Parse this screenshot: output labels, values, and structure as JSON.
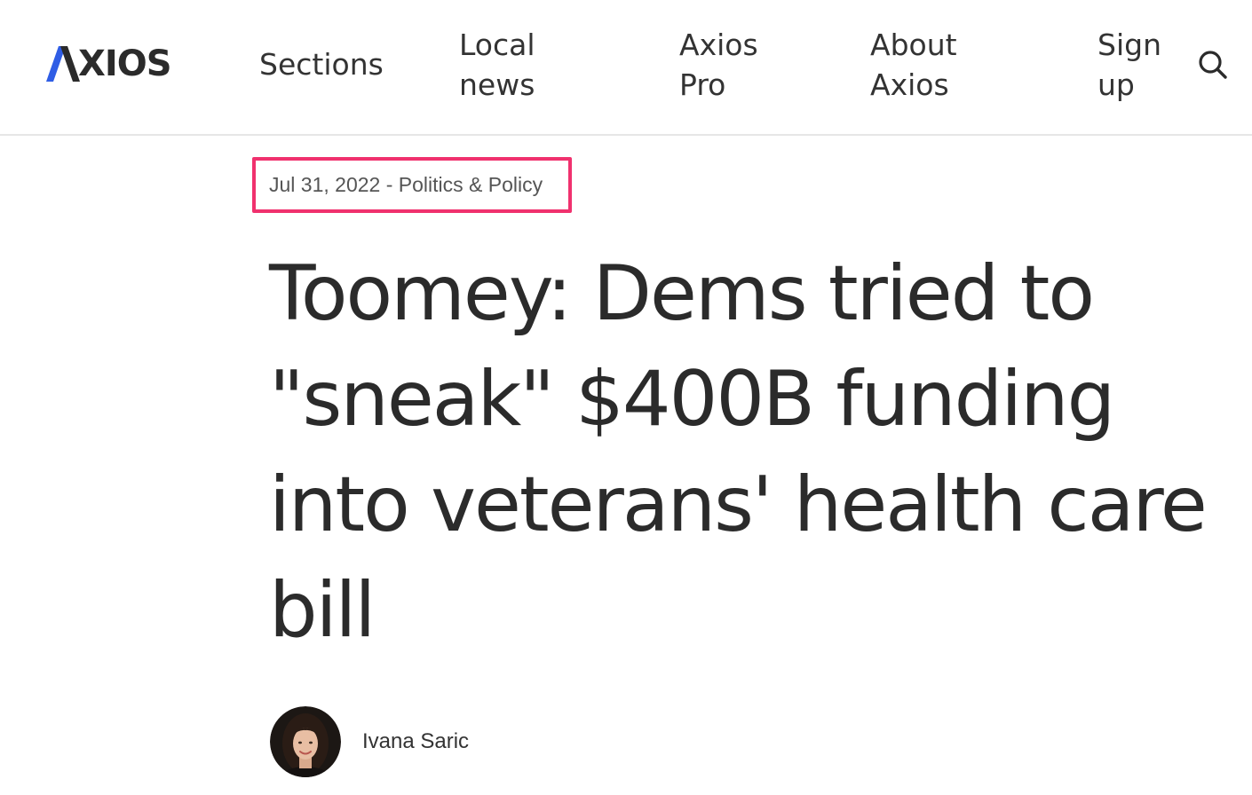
{
  "header": {
    "logo_text": "XIOS",
    "logo_label": "AXIOS",
    "logo_icon": "axios-a-mark",
    "nav": {
      "sections": "Sections",
      "local_news": "Local news",
      "axios_pro": "Axios Pro",
      "about_axios": "About Axios",
      "sign_up": "Sign up"
    },
    "search_icon": "search-icon"
  },
  "article": {
    "date": "Jul 31, 2022",
    "separator": " - ",
    "category": "Politics & Policy",
    "headline": "Toomey: Dems tried to \"sneak\" $400B funding into veterans' health care bill",
    "author": "Ivana Saric"
  },
  "colors": {
    "brand_blue": "#2f5de5",
    "text": "#2b2b2b",
    "highlight_border": "#f0316e"
  }
}
